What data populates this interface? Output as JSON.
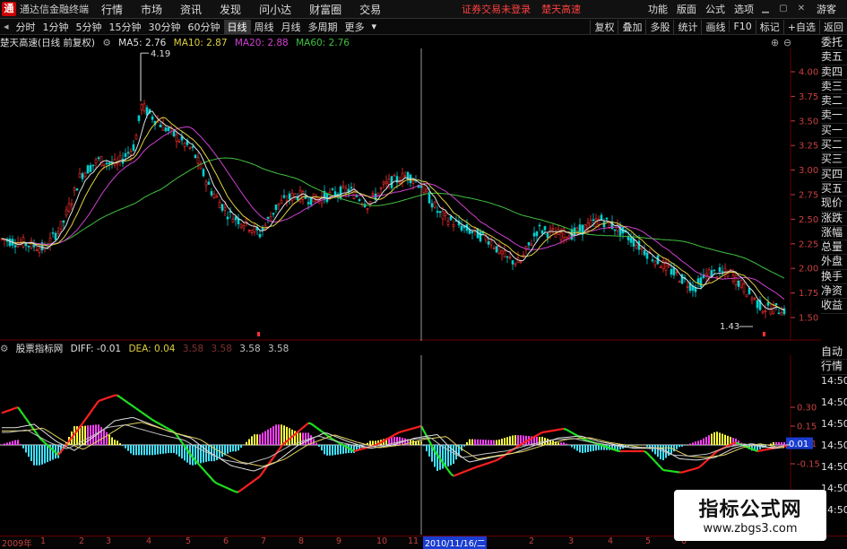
{
  "app": {
    "name": "通达信金融终端",
    "menu": [
      "行情",
      "市场",
      "资讯",
      "发现",
      "问小达",
      "财富圈",
      "交易"
    ],
    "alerts": [
      "证券交易未登录",
      "楚天高速"
    ],
    "right_menu": [
      "功能",
      "版面",
      "公式",
      "选项"
    ],
    "user": "游客"
  },
  "periods": [
    "分时",
    "1分钟",
    "5分钟",
    "15分钟",
    "30分钟",
    "60分钟",
    "日线",
    "周线",
    "月线",
    "多周期",
    "更多"
  ],
  "active_period": "日线",
  "tools": [
    "复权",
    "叠加",
    "多股",
    "统计",
    "画线",
    "F10",
    "标记",
    "+自选",
    "返回"
  ],
  "stock": {
    "title": "楚天高速(日线 前复权)",
    "ma": [
      {
        "label": "MA5: 2.76",
        "color": "#e0e0e0"
      },
      {
        "label": "MA10: 2.87",
        "color": "#e0d040"
      },
      {
        "label": "MA20: 2.88",
        "color": "#d040d0"
      },
      {
        "label": "MA60: 2.76",
        "color": "#40c040"
      }
    ],
    "high_label": "4.19",
    "low_label": "1.43",
    "y_ticks": [
      "4.00",
      "3.75",
      "3.50",
      "3.25",
      "3.00",
      "2.75",
      "2.50",
      "2.25",
      "2.00",
      "1.75",
      "1.50"
    ]
  },
  "indicator": {
    "title": "股票指标网",
    "diff": "DIFF: -0.01",
    "dea": "DEA: 0.04",
    "extra": [
      "3.58",
      "3.58"
    ],
    "extra_dim": [
      "3.58",
      "3.58"
    ],
    "y_ticks": [
      "0.30",
      "0.15",
      "0.01",
      "-0.15"
    ],
    "side_right": [
      "14:50",
      "14:50",
      "14:50",
      "14:50",
      "14:50",
      "14:50",
      "14:50"
    ],
    "current_value": "0.01"
  },
  "side_labels": [
    "委托",
    "卖五",
    "卖四",
    "卖三",
    "卖二",
    "卖一",
    "买一",
    "买二",
    "买三",
    "买四",
    "买五",
    "现价",
    "涨跌",
    "涨幅",
    "总量",
    "外盘",
    "换手",
    "净资",
    "收益"
  ],
  "side_labels_2": [
    "自动",
    "行情"
  ],
  "x_axis": {
    "year_label": "2009年",
    "cursor_date": "2010/11/16/二",
    "months": [
      "1",
      "2",
      "3",
      "4",
      "5",
      "6",
      "7",
      "8",
      "9",
      "10",
      "11",
      "1",
      "2",
      "3",
      "4",
      "5",
      "6"
    ]
  },
  "watermark": {
    "title": "指标公式网",
    "url": "www.zbgs3.com"
  },
  "colors": {
    "up": "#ff3030",
    "down": "#00d0d0",
    "ma5": "#e0e0e0",
    "ma10": "#e0d040",
    "ma20": "#d040d0",
    "ma60": "#40c040",
    "macd_pos": "#ff40ff",
    "macd_pos2": "#ffff40",
    "macd_neg": "#40e0ff"
  }
}
